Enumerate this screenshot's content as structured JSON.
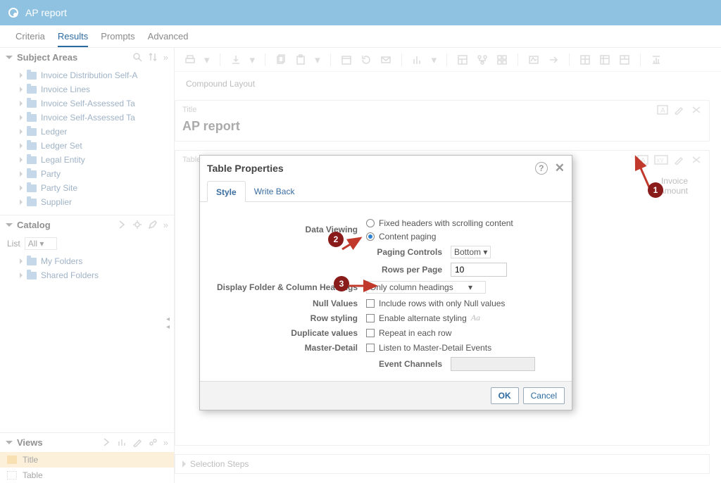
{
  "topbar": {
    "title": "AP report"
  },
  "subnav": {
    "items": [
      "Criteria",
      "Results",
      "Prompts",
      "Advanced"
    ],
    "active_index": 1
  },
  "sidebar": {
    "subject_areas": {
      "title": "Subject Areas",
      "items": [
        "Invoice Distribution Self-A",
        "Invoice Lines",
        "Invoice Self-Assessed Ta",
        "Invoice Self-Assessed Ta",
        "Ledger",
        "Ledger Set",
        "Legal Entity",
        "Party",
        "Party Site",
        "Supplier"
      ]
    },
    "catalog": {
      "title": "Catalog",
      "list_label": "List",
      "list_value": "All",
      "folders": [
        "My Folders",
        "Shared Folders"
      ]
    },
    "views": {
      "title": "Views",
      "items": [
        "Title",
        "Table"
      ],
      "selected_index": 0
    }
  },
  "compound": {
    "label": "Compound Layout",
    "title_card_label": "Title",
    "report_title": "AP report",
    "table_card_label": "Table",
    "column_header": "Invoice\nAmount",
    "selection_steps": "Selection Steps"
  },
  "dialog": {
    "title": "Table Properties",
    "tabs": [
      "Style",
      "Write Back"
    ],
    "active_tab": 0,
    "data_viewing_label": "Data Viewing",
    "opt_fixed": "Fixed headers with scrolling content",
    "opt_paging": "Content paging",
    "paging_controls_label": "Paging Controls",
    "paging_controls_value": "Bottom",
    "rows_per_page_label": "Rows per Page",
    "rows_per_page_value": "10",
    "display_headings_label": "Display Folder & Column Headings",
    "display_headings_value": "Only column headings",
    "null_values_label": "Null Values",
    "null_values_cb": "Include rows with only Null values",
    "row_styling_label": "Row styling",
    "row_styling_cb": "Enable alternate styling",
    "duplicate_label": "Duplicate values",
    "duplicate_cb": "Repeat in each row",
    "master_detail_label": "Master-Detail",
    "master_detail_cb": "Listen to Master-Detail Events",
    "event_channels_label": "Event Channels",
    "ok": "OK",
    "cancel": "Cancel"
  },
  "annotations": {
    "b1": "1",
    "b2": "2",
    "b3": "3"
  }
}
